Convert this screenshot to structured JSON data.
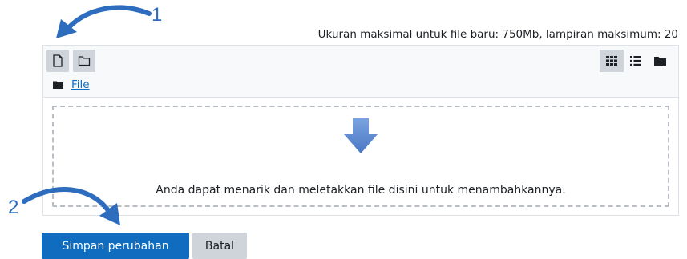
{
  "upload": {
    "limit_text": "Ukuran maksimal untuk file baru: 750Mb, lampiran maksimum: 20"
  },
  "filepicker": {
    "toolbar": {
      "add_icon": "file-icon",
      "create_folder_icon": "folder-icon",
      "views": [
        "grid-icon",
        "list-icon",
        "folder-tree-icon"
      ],
      "active_view": "grid"
    },
    "breadcrumb": {
      "label": "File"
    },
    "dropzone": {
      "message": "Anda dapat menarik dan meletakkan file disini untuk menambahkannya."
    }
  },
  "actions": {
    "save_label": "Simpan perubahan",
    "cancel_label": "Batal"
  },
  "annotations": {
    "step1": "1",
    "step2": "2"
  },
  "colors": {
    "primary": "#0f6cbf",
    "annotation": "#2e6cbd",
    "drop_arrow": "#5e8dd6"
  }
}
